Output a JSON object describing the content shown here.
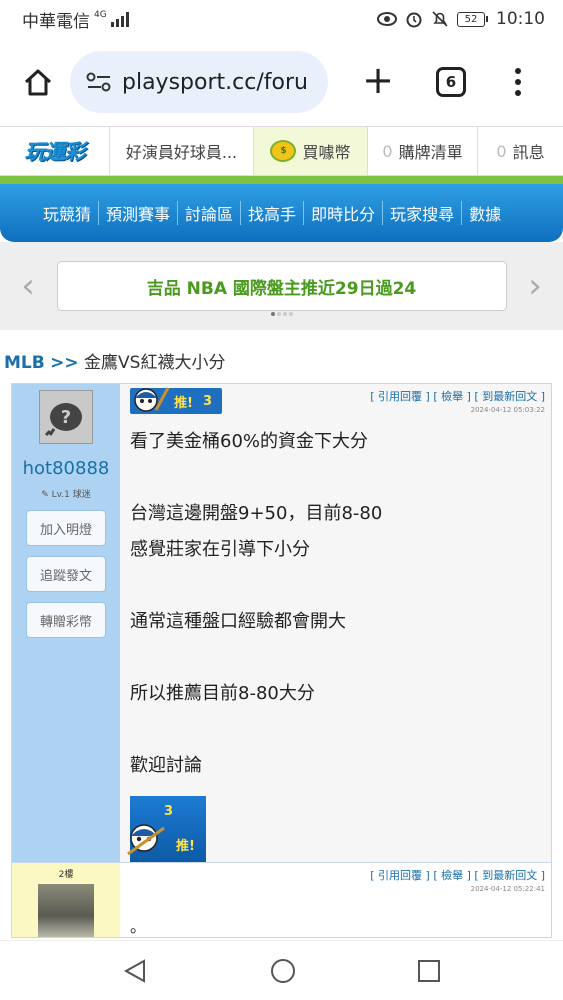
{
  "status": {
    "carrier": "中華電信",
    "network": "4G",
    "battery": "52",
    "time": "10:10"
  },
  "browser": {
    "url": "playsport.cc/foru",
    "tab_count": "6"
  },
  "site": {
    "logo": "玩運彩",
    "username": "好演員好球員...",
    "buy_coins": "買噱幣",
    "cart_count": "0",
    "cart_label": "購牌清單",
    "msg_count": "0",
    "msg_label": "訊息"
  },
  "nav": [
    "玩競猜",
    "預測賽事",
    "討論區",
    "找高手",
    "即時比分",
    "玩家搜尋",
    "數據"
  ],
  "marquee": "吉品 NBA 國際盤主推近29日過24",
  "breadcrumb": {
    "section": "MLB",
    "sep": ">>",
    "title": "金鷹VS紅襪大小分"
  },
  "post1": {
    "username": "hot80888",
    "level": "Lv.1 球迷",
    "buttons": [
      "加入明燈",
      "追蹤發文",
      "轉贈彩幣"
    ],
    "push_label": "推!",
    "push_count": "3",
    "actions": [
      "[ 引用回覆 ]",
      "[ 檢舉 ]",
      "[ 到最新回文 ]"
    ],
    "timestamp": "2024-04-12 05:03:22",
    "lines": [
      "看了美金桶60%的資金下大分",
      "",
      "台灣這邊開盤9+50，目前8-80",
      "感覺莊家在引導下小分",
      "",
      "通常這種盤口經驗都會開大",
      "",
      "所以推薦目前8-80大分",
      "",
      "歡迎討論"
    ],
    "badge_count": "3",
    "badge_label": "推!"
  },
  "post2": {
    "floor": "2樓",
    "actions": [
      "[ 引用回覆 ]",
      "[ 檢舉 ]",
      "[ 到最新回文 ]"
    ],
    "timestamp": "2024-04-12 05:22:41",
    "text": "。"
  },
  "colors": {
    "nav_blue": "#1a86d6",
    "green_strip": "#7ec242",
    "side_blue": "#aed3f2",
    "side_yellow": "#fbf8c4"
  }
}
